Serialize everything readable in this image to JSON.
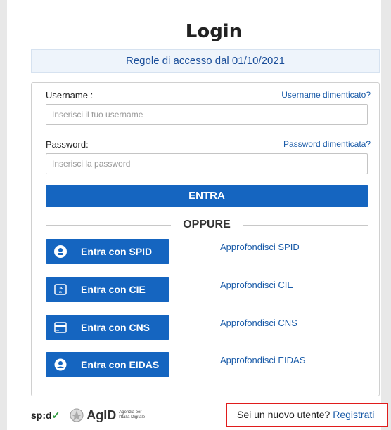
{
  "login": {
    "title": "Login",
    "notice": "Regole di accesso dal 01/10/2021"
  },
  "form": {
    "username_label": "Username :",
    "username_forgot": "Username dimenticato?",
    "username_placeholder": "Inserisci il tuo username",
    "password_label": "Password:",
    "password_forgot": "Password dimenticata?",
    "password_placeholder": "Inserisci la password",
    "submit_label": "ENTRA",
    "separator": "OPPURE"
  },
  "identity": [
    {
      "label": "Entra con SPID",
      "link": "Approfondisci SPID",
      "icon": "spid-user-icon"
    },
    {
      "label": "Entra con CIE",
      "link": "Approfondisci CIE",
      "icon": "cie-card-icon"
    },
    {
      "label": "Entra con CNS",
      "link": "Approfondisci CNS",
      "icon": "cns-card-icon"
    },
    {
      "label": "Entra con EIDAS",
      "link": "Approfondisci EIDAS",
      "icon": "eidas-user-icon"
    }
  ],
  "footer": {
    "spid_logo": "sp:d",
    "agid_logo": "AgID",
    "agid_subtitle": "Agenzia per l'Italia Digitale",
    "register_prompt": "Sei un nuovo utente?",
    "register_link": "Registrati"
  },
  "colors": {
    "primary": "#1565c0",
    "link": "#1a5ba8",
    "notice_bg": "#eef4fb",
    "highlight_border": "#e01c1c"
  }
}
